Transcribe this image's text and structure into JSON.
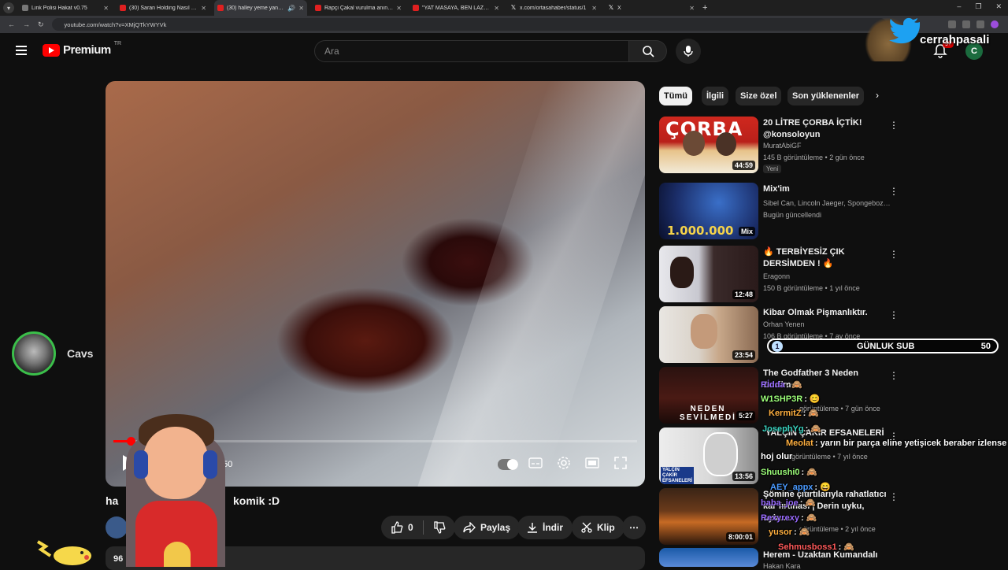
{
  "browser": {
    "tabs": [
      {
        "title": "Link Polisi Hakat v0.75",
        "icon": "grey"
      },
      {
        "title": "(30) Saran Holding Nasıl Kurulu",
        "icon": "yt"
      },
      {
        "title": "(30) halley yeme yansıması",
        "icon": "yt",
        "active": true
      },
      {
        "title": "Rapçi Çakal vurulma anını ilk k",
        "icon": "yt"
      },
      {
        "title": "\"YAT MASAYA, BEN LAZER YAP",
        "icon": "yt"
      },
      {
        "title": "x.com/ortasahaber/status/1",
        "icon": "x"
      },
      {
        "title": "X",
        "icon": "x"
      }
    ],
    "url": "youtube.com/watch?v=XMjQTkYWYVk"
  },
  "header": {
    "logo": "Premium",
    "country": "TR",
    "search_placeholder": "Ara",
    "notif_badge": "9+",
    "avatar_letter": "C"
  },
  "overlay": {
    "brand_name": "cerrahpasali",
    "viewer_name": "Cavs",
    "sub_goal_label": "GÜNLUK SUB",
    "sub_goal_current": "1",
    "sub_goal_target": "50"
  },
  "video": {
    "time": "3:50",
    "progress": 0.033,
    "title_left": "ha",
    "title_right": "komik :D",
    "like_count": "0",
    "share_label": "Paylaş",
    "download_label": "İndir",
    "clip_label": "Klip",
    "desc_start": "96"
  },
  "chips": [
    "Tümü",
    "İlgili",
    "Size özel",
    "Son yüklenenler"
  ],
  "recs": [
    {
      "title": "20 LİTRE ÇORBA İÇTİK! @konsoloyun",
      "channel": "MuratAbiGF",
      "meta": "145 B görüntüleme • 2 gün önce",
      "dur": "44:59",
      "tag": "Yeni",
      "thumb_text": "ÇORBA"
    },
    {
      "title": "Mix'im",
      "channel": "Sibel Can, Lincoln Jaeger, Spongebozz v...",
      "meta": "Bugün güncellendi",
      "dur": "Mix",
      "thumb_text": "1.000.000"
    },
    {
      "title": "🔥 TERBİYESİZ ÇIK DERSİMDEN ! 🔥",
      "channel": "Eragonn",
      "meta": "150 B görüntüleme • 1 yıl önce",
      "dur": "12:48"
    },
    {
      "title": "Kibar Olmak Pişmanlıktır.",
      "channel": "Orhan Yenen",
      "meta": "106 B görüntüleme • 7 ay önce",
      "dur": "23:54"
    },
    {
      "title": "The Godfather 3 Neden Sevilme",
      "channel": "",
      "meta": "görüntüleme • 7 gün önce",
      "dur": "5:27",
      "thumb_text": "NEDEN SEVİLMEDİ"
    },
    {
      "title": "YALÇIN ÇAKIR EFSANELERİ",
      "channel": "",
      "meta": "görüntüleme • 7 yıl önce",
      "dur": "13:56",
      "thumb_text": "YALÇIN ÇAKIR EFSANELERİ"
    },
    {
      "title": "Şömine çıtırtılarıyla rahatlatıcı kar fırtınası | Derin uyku, uyku...",
      "channel": "",
      "meta": "görüntüleme • 2 yıl önce",
      "dur": "8:00:01"
    },
    {
      "title": "Herem - Uzaktan Kumandalı",
      "channel": "Hakan Kara",
      "meta": "",
      "dur": ""
    }
  ],
  "chat": [
    {
      "user": "Rİdda",
      "text": ": 🙈"
    },
    {
      "user": "W1SHP3R",
      "text": ": 😊"
    },
    {
      "user": "KermitZ",
      "text": ": 🙈"
    },
    {
      "user": "JosephYg",
      "text": ": 🙈"
    },
    {
      "user": "Meolat",
      "text": ": yarın bir parça eline yetişicek beraber izlense"
    },
    {
      "user": "",
      "text": "hoj olur"
    },
    {
      "user": "Shuushi0",
      "text": ": 🙈"
    },
    {
      "user": "AEY_appx",
      "text": ": 😄"
    },
    {
      "user": "baba_joe",
      "text": ": 🙈"
    },
    {
      "user": "Rexyrexy",
      "text": ": 🙈"
    },
    {
      "user": "yusor",
      "text": ": 🙈"
    },
    {
      "user": "Sehmusboss1",
      "text": ": 🙈"
    }
  ],
  "colors": {
    "accent": "#ff0000",
    "bg": "#0f0f0f",
    "chip": "#272727"
  }
}
